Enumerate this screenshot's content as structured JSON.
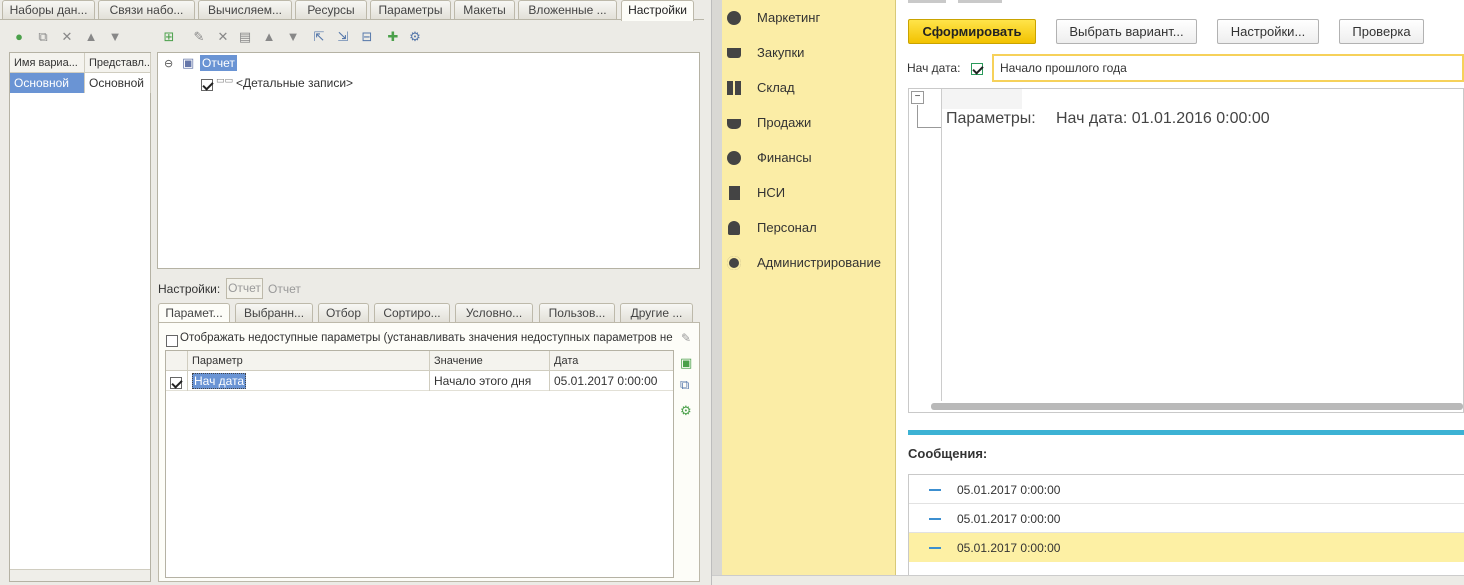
{
  "editor": {
    "top_tabs": [
      "Наборы дан...",
      "Связи набо...",
      "Вычисляем...",
      "Ресурсы",
      "Параметры",
      "Макеты",
      "Вложенные ...",
      "Настройки"
    ],
    "variants_grid": {
      "headers": [
        "Имя вариа...",
        "Представл..."
      ],
      "rows": [
        [
          "Основной",
          "Основной"
        ]
      ]
    },
    "structure_tree": {
      "root": "Отчет",
      "child": "<Детальные записи>"
    },
    "settings_label": "Настройки:",
    "settings_buttons": [
      "Отчет",
      "Отчет"
    ],
    "sub_tabs": [
      "Парамет...",
      "Выбранн...",
      "Отбор",
      "Сортиро...",
      "Условно...",
      "Пользов...",
      "Другие ..."
    ],
    "show_unavailable_label": "Отображать недоступные параметры (устанавливать значения недоступных параметров не ре...",
    "params_grid": {
      "headers": [
        "Параметр",
        "Значение",
        "Дата"
      ],
      "rows": [
        {
          "checked": true,
          "param": "Нач дата",
          "value": "Начало этого дня",
          "date": "05.01.2017 0:00:00"
        }
      ]
    }
  },
  "app": {
    "nav": [
      {
        "label": "Маркетинг",
        "icon": "pie-chart-icon"
      },
      {
        "label": "Закупки",
        "icon": "cart-icon"
      },
      {
        "label": "Склад",
        "icon": "grid-icon"
      },
      {
        "label": "Продажи",
        "icon": "basket-icon"
      },
      {
        "label": "Финансы",
        "icon": "ruble-icon"
      },
      {
        "label": "НСИ",
        "icon": "copy-icon"
      },
      {
        "label": "Персонал",
        "icon": "person-icon"
      },
      {
        "label": "Администрирование",
        "icon": "gear-icon"
      }
    ],
    "buttons": {
      "generate": "Сформировать",
      "choose_variant": "Выбрать вариант...",
      "settings": "Настройки...",
      "check": "Проверка"
    },
    "start_date_label": "Нач дата:",
    "start_date_value": "Начало прошлого года",
    "report_text_label": "Параметры:",
    "report_text_value": "Нач дата: 01.01.2016 0:00:00",
    "messages_title": "Сообщения:",
    "messages": [
      "05.01.2017 0:00:00",
      "05.01.2017 0:00:00",
      "05.01.2017 0:00:00"
    ],
    "colors": {
      "accent_yellow": "#f6c800",
      "sidebar": "#fbeda6",
      "divider_blue": "#3cb2d4",
      "selected_message": "#fdf0a4"
    }
  }
}
